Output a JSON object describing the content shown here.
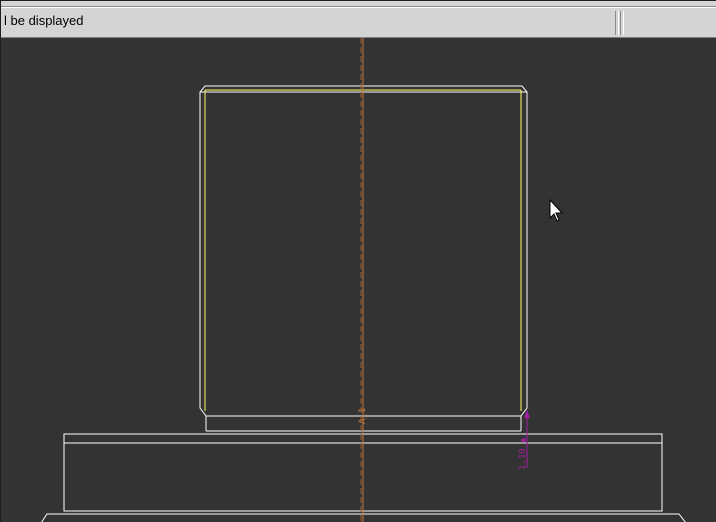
{
  "status": {
    "message": "l be displayed"
  },
  "annotations": {
    "center_label": "A_1",
    "side_label": "1.10 ▲"
  },
  "colors": {
    "background": "#333333",
    "topbar": "#d4d4d4",
    "outline": "#ffffff",
    "highlight": "#ffff66",
    "centerline": "#c8783c",
    "dimension": "#a020a0"
  },
  "icons": {
    "cursor": "arrow-pointer-icon"
  }
}
